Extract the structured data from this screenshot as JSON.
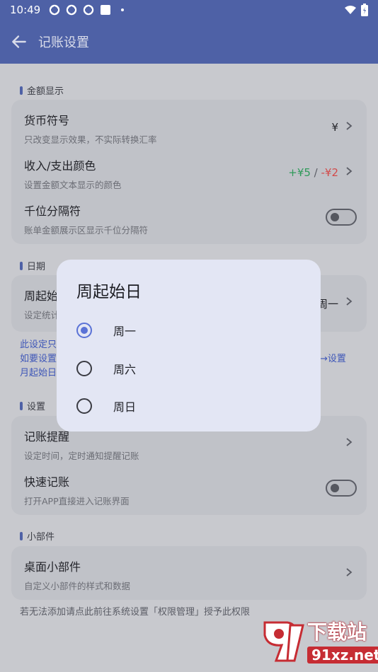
{
  "status": {
    "time": "10:49"
  },
  "appbar": {
    "title": "记账设置"
  },
  "sections": {
    "amount": {
      "title": "金额显示",
      "currency": {
        "title": "货币符号",
        "subtitle": "只改变显示效果，不实际转换汇率",
        "value": "¥"
      },
      "color": {
        "title": "收入/支出颜色",
        "subtitle": "设置金额文本显示的颜色",
        "income": "+¥5",
        "sep": " / ",
        "expense": "-¥2"
      },
      "thousands": {
        "title": "千位分隔符",
        "subtitle": "账单金额展示区显示千位分隔符"
      }
    },
    "date": {
      "title": "日期",
      "week_start": {
        "title": "周起始日",
        "subtitle": "设定统计",
        "value": "周一"
      },
      "note_line1": "此设定只",
      "note_line2": "如要设置",
      "note_line2_right": "→设置",
      "note_line3": "月起始日"
    },
    "settings": {
      "title": "设置",
      "reminder": {
        "title": "记账提醒",
        "subtitle": "设定时间，定时通知提醒记账"
      },
      "quick": {
        "title": "快速记账",
        "subtitle": "打开APP直接进入记账界面"
      }
    },
    "widget": {
      "title": "小部件",
      "desktop": {
        "title": "桌面小部件",
        "subtitle": "自定义小部件的样式和数据"
      },
      "note": "若无法添加请点此前往系统设置「权限管理」授予此权限"
    }
  },
  "dialog": {
    "title": "周起始日",
    "options": [
      {
        "label": "周一",
        "selected": true
      },
      {
        "label": "周六",
        "selected": false
      },
      {
        "label": "周日",
        "selected": false
      }
    ]
  },
  "watermark": {
    "title": "下载站",
    "url": "91xz.net"
  },
  "colors": {
    "primary": "#4e61a6",
    "income": "#2f9a5a",
    "expense": "#d24a4a",
    "radio_selected": "#5a72d6"
  }
}
